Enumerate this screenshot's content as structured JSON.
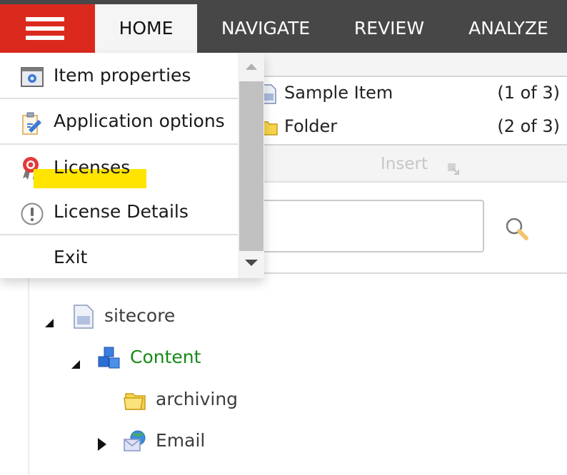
{
  "topbar": {
    "menu_button_label": "Menu",
    "tabs": [
      {
        "label": "HOME",
        "active": true
      },
      {
        "label": "NAVIGATE",
        "active": false
      },
      {
        "label": "REVIEW",
        "active": false
      },
      {
        "label": "ANALYZE",
        "active": false
      }
    ]
  },
  "gallery": {
    "items": [
      {
        "label": "Sample Item",
        "count": "(1 of 3)",
        "icon": "document-icon"
      },
      {
        "label": "Folder",
        "count": "(2 of 3)",
        "icon": "folder-icon"
      }
    ],
    "insert_label": "Insert"
  },
  "search": {
    "value": "",
    "placeholder": ""
  },
  "tree": {
    "nodes": [
      {
        "label": "sitecore",
        "icon": "document-icon",
        "expanded": true,
        "color": "#3d3d3d"
      },
      {
        "label": "Content",
        "icon": "content-cubes-icon",
        "expanded": true,
        "color": "#168a16"
      },
      {
        "label": "archiving",
        "icon": "folder-icon",
        "expanded": null,
        "color": "#3d3d3d"
      },
      {
        "label": "Email",
        "icon": "email-globe-icon",
        "expanded": false,
        "color": "#3d3d3d"
      }
    ]
  },
  "menu": {
    "items": [
      {
        "label": "Item properties",
        "icon": "item-properties-icon"
      },
      {
        "label": "Application options",
        "icon": "application-options-icon"
      },
      {
        "label": "Licenses",
        "icon": "licenses-ribbon-icon",
        "highlighted": true
      },
      {
        "label": "License Details",
        "icon": "info-exclamation-icon"
      },
      {
        "label": "Exit",
        "icon": ""
      }
    ]
  },
  "colors": {
    "accent_red": "#dc291e",
    "topbar_bg": "#474747",
    "highlight_yellow": "#ffe400",
    "content_green": "#168a16"
  }
}
